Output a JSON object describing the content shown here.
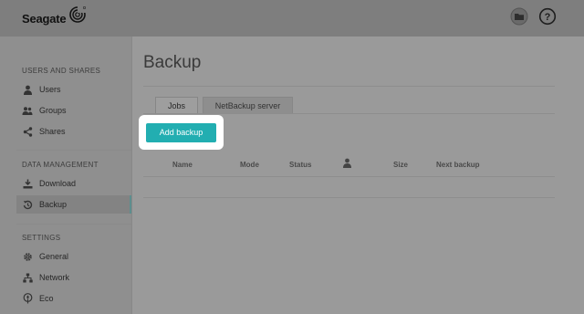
{
  "header": {
    "logo_text": "Seagate",
    "folder_icon": "folder-icon",
    "help_icon": "help-icon"
  },
  "sidebar": {
    "sections": [
      {
        "title": "USERS AND SHARES"
      },
      {
        "title": "DATA MANAGEMENT"
      },
      {
        "title": "SETTINGS"
      }
    ],
    "items": [
      {
        "label": "Users",
        "icon": "user-icon"
      },
      {
        "label": "Groups",
        "icon": "group-icon"
      },
      {
        "label": "Shares",
        "icon": "share-icon"
      },
      {
        "label": "Download",
        "icon": "download-icon"
      },
      {
        "label": "Backup",
        "icon": "backup-icon",
        "active": true
      },
      {
        "label": "General",
        "icon": "gear-icon"
      },
      {
        "label": "Network",
        "icon": "network-icon"
      },
      {
        "label": "Eco",
        "icon": "eco-icon"
      }
    ]
  },
  "main": {
    "title": "Backup",
    "tabs": [
      {
        "label": "Jobs",
        "active": true
      },
      {
        "label": "NetBackup server"
      }
    ],
    "add_button": "Add backup",
    "columns": [
      "Name",
      "Mode",
      "Status",
      "",
      "Size",
      "Next backup"
    ],
    "owner_column_icon": "user-icon"
  },
  "colors": {
    "accent": "#22aeb1",
    "overlay_background": "#9a9a9a"
  }
}
